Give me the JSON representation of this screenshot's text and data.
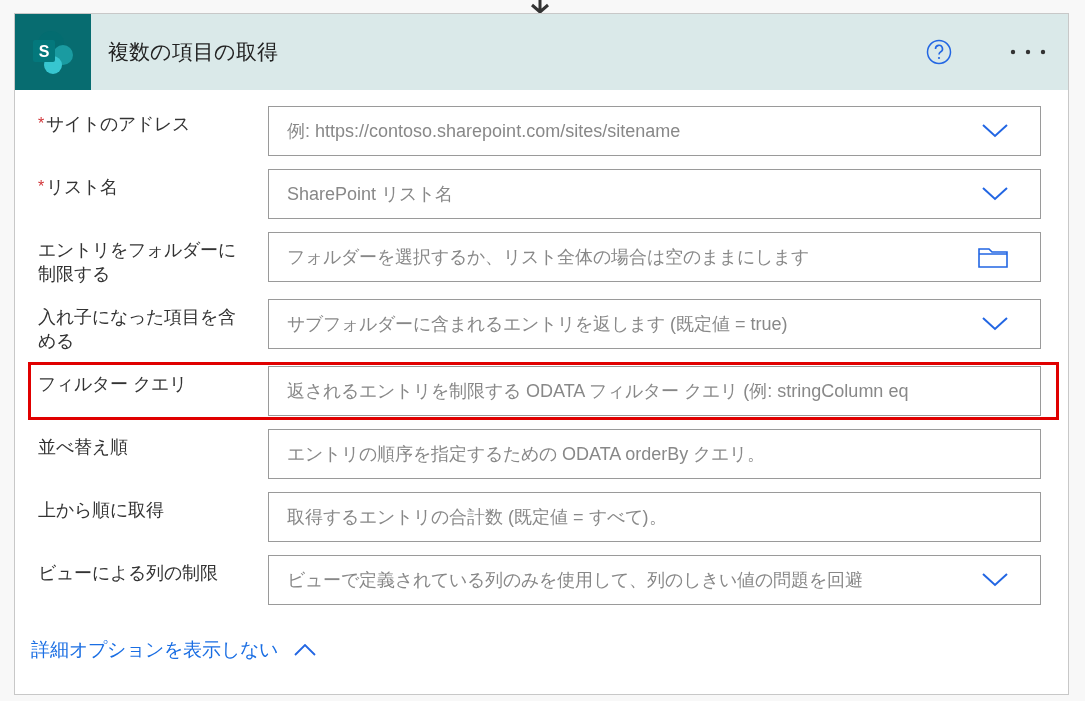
{
  "card": {
    "logo_letter": "S",
    "title": "複数の項目の取得"
  },
  "fields": [
    {
      "label": "サイトのアドレス",
      "required": true,
      "required_mark": "*",
      "kind": "dropdown",
      "placeholder": "例: https://contoso.sharepoint.com/sites/sitename",
      "highlighted": false
    },
    {
      "label": "リスト名",
      "required": true,
      "required_mark": "*",
      "kind": "dropdown",
      "placeholder": "SharePoint リスト名",
      "highlighted": false
    },
    {
      "label": "エントリをフォルダーに制限する",
      "required": false,
      "kind": "folder",
      "placeholder": "フォルダーを選択するか、リスト全体の場合は空のままにします",
      "highlighted": false
    },
    {
      "label": "入れ子になった項目を含める",
      "required": false,
      "kind": "dropdown",
      "placeholder": "サブフォルダーに含まれるエントリを返します (既定値 = true)",
      "highlighted": false
    },
    {
      "label": "フィルター クエリ",
      "required": false,
      "kind": "text",
      "placeholder": "返されるエントリを制限する ODATA フィルター クエリ (例: stringColumn eq",
      "highlighted": true
    },
    {
      "label": "並べ替え順",
      "required": false,
      "kind": "text",
      "placeholder": "エントリの順序を指定するための ODATA orderBy クエリ。",
      "highlighted": false
    },
    {
      "label": "上から順に取得",
      "required": false,
      "kind": "text",
      "placeholder": "取得するエントリの合計数 (既定値 = すべて)。",
      "highlighted": false
    },
    {
      "label": "ビューによる列の制限",
      "required": false,
      "kind": "dropdown",
      "placeholder": "ビューで定義されている列のみを使用して、列のしきい値の問題を回避",
      "highlighted": false
    }
  ],
  "advanced_link": {
    "label": "詳細オプションを表示しない",
    "expanded": true
  }
}
